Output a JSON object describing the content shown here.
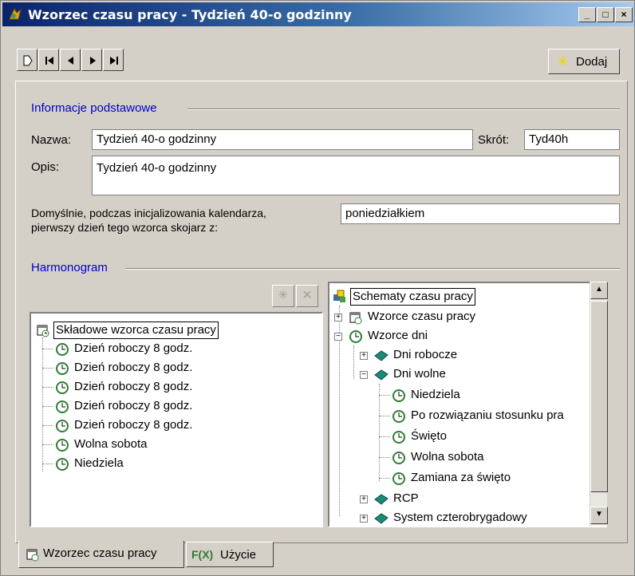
{
  "window": {
    "title": "Wzorzec czasu pracy - Tydzień 40-o godzinny",
    "min_glyph": "_",
    "max_glyph": "□",
    "close_glyph": "×"
  },
  "toolbar": {
    "nav_buttons": [
      "new-record-icon",
      "first-record-icon",
      "previous-record-icon",
      "next-record-icon",
      "last-record-icon"
    ],
    "add_label": "Dodaj",
    "add_icon_glyph": "✳"
  },
  "basic": {
    "section_label": "Informacje podstawowe",
    "name_label": "Nazwa:",
    "name_value": "Tydzień 40-o godzinny",
    "short_label": "Skrót:",
    "short_value": "Tyd40h",
    "desc_label": "Opis:",
    "desc_value": "Tydzień 40-o godzinny",
    "default_label_line1": "Domyślnie, podczas inicjalizowania kalendarza,",
    "default_label_line2": "pierwszy dzień tego wzorca skojarz z:",
    "default_value": "poniedziałkiem"
  },
  "schedule": {
    "section_label": "Harmonogram",
    "left_tree": {
      "root": "Składowe wzorca czasu pracy",
      "items": [
        "Dzień roboczy 8 godz.",
        "Dzień roboczy 8 godz.",
        "Dzień roboczy 8 godz.",
        "Dzień roboczy 8 godz.",
        "Dzień roboczy 8 godz.",
        "Wolna sobota",
        "Niedziela"
      ]
    },
    "right_tree": {
      "root": "Schematy czasu pracy",
      "n1": "Wzorce czasu pracy",
      "n2": "Wzorce dni",
      "n2a": "Dni robocze",
      "n2b": "Dni wolne",
      "n2b_items": [
        "Niedziela",
        "Po rozwiązaniu stosunku pra",
        "Święto",
        "Wolna sobota",
        "Zamiana za święto"
      ],
      "n3": "RCP",
      "n4": "System czterobrygadowy"
    }
  },
  "tabs": {
    "tab1": "Wzorzec czasu pracy",
    "tab2": "Użycie",
    "tab2_icon_text": "F(X)"
  },
  "colors": {
    "section_blue": "#0000c8",
    "title_gradient_start": "#0a246a",
    "clock_green": "#2e7d32",
    "book_teal": "#1a8a7a"
  }
}
